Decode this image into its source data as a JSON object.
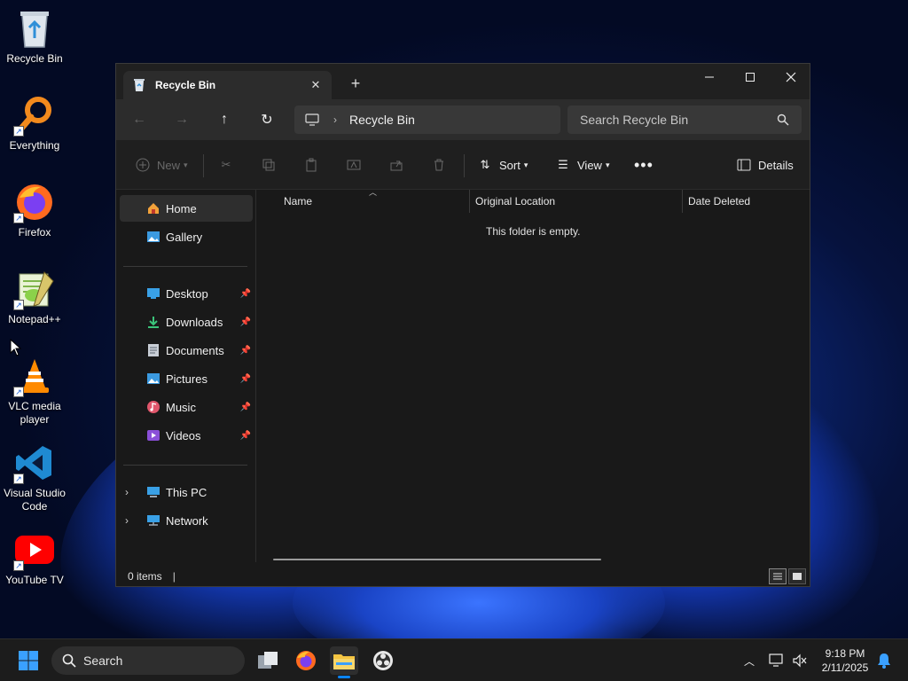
{
  "desktop": {
    "icons": [
      {
        "label": "Recycle Bin"
      },
      {
        "label": "Everything"
      },
      {
        "label": "Firefox"
      },
      {
        "label": "Notepad++"
      },
      {
        "label": "VLC media player"
      },
      {
        "label": "Visual Studio Code"
      },
      {
        "label": "YouTube TV"
      }
    ]
  },
  "window": {
    "tab_title": "Recycle Bin",
    "address": {
      "crumb": "Recycle Bin"
    },
    "search": {
      "placeholder": "Search Recycle Bin"
    },
    "toolbar": {
      "new_label": "New",
      "sort_label": "Sort",
      "view_label": "View",
      "details_label": "Details"
    },
    "sidebar": {
      "home": "Home",
      "gallery": "Gallery",
      "desktop": "Desktop",
      "downloads": "Downloads",
      "documents": "Documents",
      "pictures": "Pictures",
      "music": "Music",
      "videos": "Videos",
      "this_pc": "This PC",
      "network": "Network"
    },
    "columns": [
      "Name",
      "Original Location",
      "Date Deleted"
    ],
    "empty_message": "This folder is empty.",
    "status": "0 items"
  },
  "taskbar": {
    "search_label": "Search",
    "time": "9:18 PM",
    "date": "2/11/2025"
  },
  "colors": {
    "accent": "#0a84ff",
    "window_bg": "#191919",
    "navbar_bg": "#2c2c2c"
  }
}
